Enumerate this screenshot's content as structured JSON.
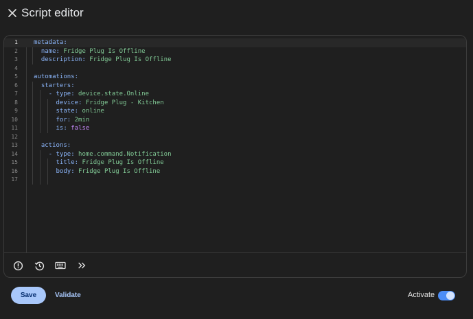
{
  "header": {
    "title": "Script editor",
    "close_icon": "close-icon"
  },
  "editor": {
    "active_line": 1,
    "lines": [
      {
        "n": "1",
        "parts": [
          [
            "k",
            "metadata:"
          ]
        ]
      },
      {
        "n": "2",
        "parts": [
          [
            "t",
            "  "
          ],
          [
            "k",
            "name:"
          ],
          [
            "t",
            " "
          ],
          [
            "s",
            "Fridge Plug Is Offline"
          ]
        ]
      },
      {
        "n": "3",
        "parts": [
          [
            "t",
            "  "
          ],
          [
            "k",
            "description:"
          ],
          [
            "t",
            " "
          ],
          [
            "s",
            "Fridge Plug Is Offline"
          ]
        ]
      },
      {
        "n": "4",
        "parts": []
      },
      {
        "n": "5",
        "parts": [
          [
            "k",
            "automations:"
          ]
        ]
      },
      {
        "n": "6",
        "parts": [
          [
            "t",
            "  "
          ],
          [
            "k",
            "starters:"
          ]
        ]
      },
      {
        "n": "7",
        "parts": [
          [
            "t",
            "    "
          ],
          [
            "dash",
            "- "
          ],
          [
            "k",
            "type:"
          ],
          [
            "t",
            " "
          ],
          [
            "s",
            "device.state.Online"
          ]
        ]
      },
      {
        "n": "8",
        "parts": [
          [
            "t",
            "      "
          ],
          [
            "k",
            "device:"
          ],
          [
            "t",
            " "
          ],
          [
            "s",
            "Fridge Plug - Kitchen"
          ]
        ]
      },
      {
        "n": "9",
        "parts": [
          [
            "t",
            "      "
          ],
          [
            "k",
            "state:"
          ],
          [
            "t",
            " "
          ],
          [
            "s",
            "online"
          ]
        ]
      },
      {
        "n": "10",
        "parts": [
          [
            "t",
            "      "
          ],
          [
            "k",
            "for:"
          ],
          [
            "t",
            " "
          ],
          [
            "s",
            "2min"
          ]
        ]
      },
      {
        "n": "11",
        "parts": [
          [
            "t",
            "      "
          ],
          [
            "k",
            "is:"
          ],
          [
            "t",
            " "
          ],
          [
            "b",
            "false"
          ]
        ]
      },
      {
        "n": "12",
        "parts": []
      },
      {
        "n": "13",
        "parts": [
          [
            "t",
            "  "
          ],
          [
            "k",
            "actions:"
          ]
        ]
      },
      {
        "n": "14",
        "parts": [
          [
            "t",
            "    "
          ],
          [
            "dash",
            "- "
          ],
          [
            "k",
            "type:"
          ],
          [
            "t",
            " "
          ],
          [
            "s",
            "home.command.Notification"
          ]
        ]
      },
      {
        "n": "15",
        "parts": [
          [
            "t",
            "      "
          ],
          [
            "k",
            "title:"
          ],
          [
            "t",
            " "
          ],
          [
            "s",
            "Fridge Plug Is Offline"
          ]
        ]
      },
      {
        "n": "16",
        "parts": [
          [
            "t",
            "      "
          ],
          [
            "k",
            "body:"
          ],
          [
            "t",
            " "
          ],
          [
            "s",
            "Fridge Plug Is Offline"
          ]
        ]
      },
      {
        "n": "17",
        "parts": []
      }
    ]
  },
  "toolbar": {
    "icons": [
      "error-icon",
      "history-icon",
      "keyboard-icon",
      "chevron-double-right-icon"
    ]
  },
  "footer": {
    "save_label": "Save",
    "validate_label": "Validate",
    "activate_label": "Activate",
    "activate_on": true
  },
  "colors": {
    "accent": "#a8c7fa",
    "toggle": "#4c8df6",
    "key": "#8ab4f8",
    "string": "#81c995",
    "boolean": "#c58af9"
  }
}
